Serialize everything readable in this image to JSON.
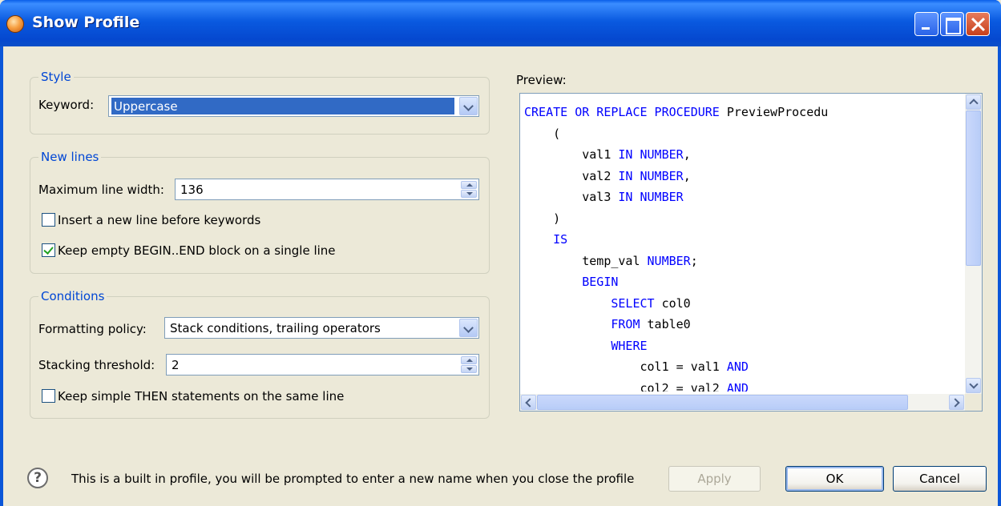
{
  "window": {
    "title": "Show Profile",
    "icon": "app-icon"
  },
  "style_group": {
    "title": "Style",
    "keyword_label": "Keyword:",
    "keyword_value": "Uppercase"
  },
  "new_lines_group": {
    "title": "New lines",
    "max_width_label": "Maximum line width:",
    "max_width_value": "136",
    "insert_newline_label": "Insert a new line before keywords",
    "insert_newline_checked": false,
    "keep_empty_label": "Keep empty BEGIN..END block on a single line",
    "keep_empty_checked": true
  },
  "conditions_group": {
    "title": "Conditions",
    "policy_label": "Formatting policy:",
    "policy_value": "Stack conditions, trailing operators",
    "threshold_label": "Stacking threshold:",
    "threshold_value": "2",
    "keep_then_label": "Keep simple THEN statements on the same line",
    "keep_then_checked": false
  },
  "preview": {
    "label": "Preview:",
    "lines": [
      [
        {
          "t": "CREATE OR REPLACE PROCEDURE",
          "k": true
        },
        {
          "t": " PreviewProcedu",
          "k": false
        }
      ],
      [
        {
          "t": "    (",
          "k": false
        }
      ],
      [
        {
          "t": "        val1 ",
          "k": false
        },
        {
          "t": "IN NUMBER",
          "k": true
        },
        {
          "t": ",",
          "k": false
        }
      ],
      [
        {
          "t": "        val2 ",
          "k": false
        },
        {
          "t": "IN NUMBER",
          "k": true
        },
        {
          "t": ",",
          "k": false
        }
      ],
      [
        {
          "t": "        val3 ",
          "k": false
        },
        {
          "t": "IN NUMBER",
          "k": true
        }
      ],
      [
        {
          "t": "    )",
          "k": false
        }
      ],
      [
        {
          "t": "    ",
          "k": false
        },
        {
          "t": "IS",
          "k": true
        }
      ],
      [
        {
          "t": "        temp_val ",
          "k": false
        },
        {
          "t": "NUMBER",
          "k": true
        },
        {
          "t": ";",
          "k": false
        }
      ],
      [
        {
          "t": "        ",
          "k": false
        },
        {
          "t": "BEGIN",
          "k": true
        }
      ],
      [
        {
          "t": "            ",
          "k": false
        },
        {
          "t": "SELECT",
          "k": true
        },
        {
          "t": " col0",
          "k": false
        }
      ],
      [
        {
          "t": "            ",
          "k": false
        },
        {
          "t": "FROM",
          "k": true
        },
        {
          "t": " table0",
          "k": false
        }
      ],
      [
        {
          "t": "            ",
          "k": false
        },
        {
          "t": "WHERE",
          "k": true
        }
      ],
      [
        {
          "t": "                col1 = val1 ",
          "k": false
        },
        {
          "t": "AND",
          "k": true
        }
      ],
      [
        {
          "t": "                col2 = val2 ",
          "k": false
        },
        {
          "t": "AND",
          "k": true
        }
      ]
    ],
    "keyword_color": "#0000ff"
  },
  "footer": {
    "info_text": "This is a built in profile, you will be prompted to enter a new name when you close the profile",
    "apply_label": "Apply",
    "ok_label": "OK",
    "cancel_label": "Cancel",
    "help_icon_glyph": "?"
  }
}
